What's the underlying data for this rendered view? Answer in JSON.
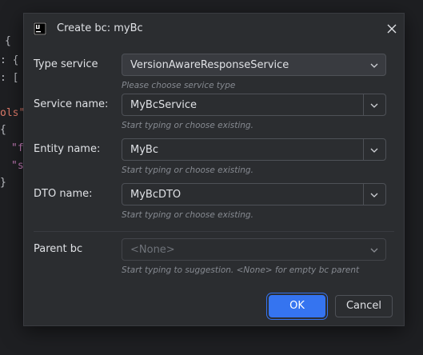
{
  "background_code": {
    "lines": [
      "{",
      ": {",
      ": [",
      "ols\"",
      "{",
      "\"f",
      "\"s",
      "}"
    ]
  },
  "dialog": {
    "title": "Create bc: myBc",
    "close_icon": "close-icon",
    "fields": {
      "type_service": {
        "label": "Type service",
        "value": "VersionAwareResponseService",
        "hint": "Please choose service type"
      },
      "service_name": {
        "label": "Service name:",
        "value": "MyBcService",
        "hint": "Start typing or choose existing."
      },
      "entity_name": {
        "label": "Entity name:",
        "value": "MyBc",
        "hint": "Start typing or choose existing."
      },
      "dto_name": {
        "label": "DTO name:",
        "value": "MyBcDTO",
        "hint": "Start typing or choose existing."
      },
      "parent_bc": {
        "label": "Parent bc",
        "value": "<None>",
        "hint": "Start typing to suggestion. <None> for empty bc parent"
      }
    },
    "buttons": {
      "ok": "OK",
      "cancel": "Cancel"
    },
    "colors": {
      "accent": "#3574f0",
      "background": "#2b2d30",
      "text": "#dfe1e5",
      "hint": "#868a91"
    }
  }
}
